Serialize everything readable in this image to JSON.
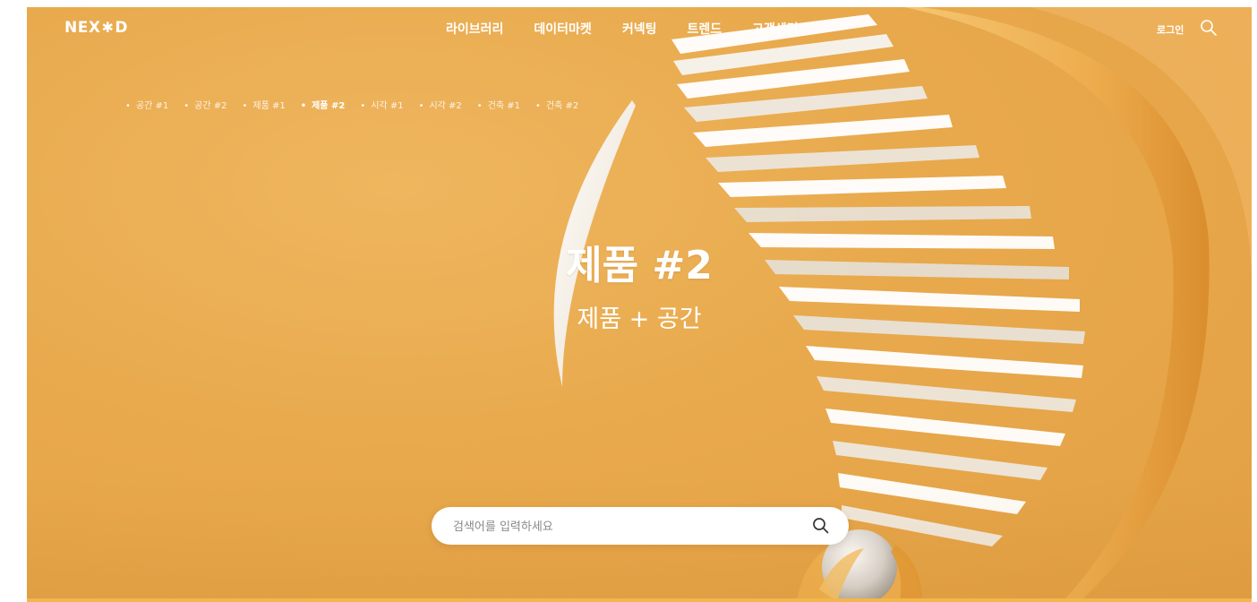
{
  "brand": {
    "logo_left": "NEX",
    "logo_mid": "✱",
    "logo_right": "D"
  },
  "nav": {
    "items": [
      "라이브러리",
      "데이터마켓",
      "커넥팅",
      "트렌드",
      "고객센터"
    ]
  },
  "header": {
    "login_label": "로그인",
    "search_icon": "search-icon"
  },
  "categories": {
    "items": [
      "공간 #1",
      "공간 #2",
      "제품 #1",
      "제품 #2",
      "시각 #1",
      "시각 #2",
      "건축 #1",
      "건축 #2"
    ],
    "active": "제품 #2"
  },
  "hero": {
    "title": "제품 #2",
    "subtitle": "제품 + 공간"
  },
  "search": {
    "placeholder": "검색어를 입력하세요",
    "value": "",
    "icon": "search-icon"
  },
  "colors": {
    "background": "#e8a94c",
    "text": "#ffffff"
  }
}
